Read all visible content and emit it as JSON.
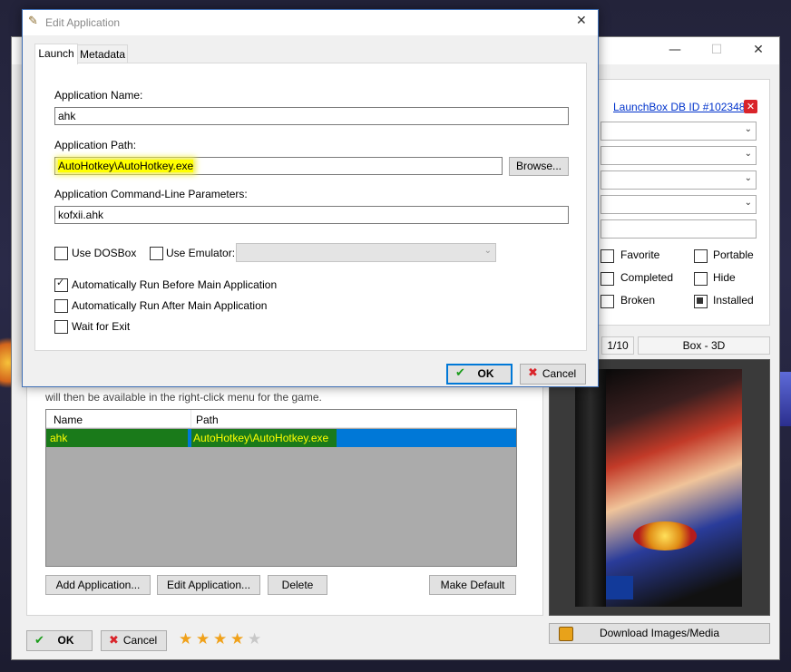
{
  "dialog": {
    "title": "Edit Application",
    "tabs": [
      {
        "label": "Launch"
      },
      {
        "label": "Metadata"
      }
    ],
    "app_name_label": "Application Name:",
    "app_name_value": "ahk",
    "app_path_label": "Application Path:",
    "app_path_value": "AutoHotkey\\AutoHotkey.exe",
    "browse_label": "Browse...",
    "cmdline_label": "Application Command-Line Parameters:",
    "cmdline_value": "kofxii.ahk",
    "use_dosbox_label": "Use DOSBox",
    "use_dosbox_checked": false,
    "use_emulator_label": "Use Emulator:",
    "use_emulator_checked": false,
    "emulator_value": "",
    "auto_run_before_label": "Automatically Run Before Main Application",
    "auto_run_before_checked": true,
    "auto_run_after_label": "Automatically Run After Main Application",
    "auto_run_after_checked": false,
    "wait_for_exit_label": "Wait for Exit",
    "wait_for_exit_checked": false,
    "ok_label": "OK",
    "cancel_label": "Cancel"
  },
  "parent": {
    "caption_text": "will then be available in the right-click menu for the game.",
    "launchbox_link": "LaunchBox DB ID #102348",
    "flags": [
      {
        "label": "Favorite",
        "checked": false
      },
      {
        "label": "Portable",
        "checked": false
      },
      {
        "label": "Completed",
        "checked": false
      },
      {
        "label": "Hide",
        "checked": false
      },
      {
        "label": "Broken",
        "checked": false
      },
      {
        "label": "Installed",
        "checked": true
      }
    ],
    "image_counter": "1/10",
    "image_type": "Box - 3D",
    "download_label": "Download Images/Media",
    "list_columns": [
      "Name",
      "Path"
    ],
    "list_rows": [
      {
        "name": "ahk",
        "path": "AutoHotkey\\AutoHotkey.exe"
      }
    ],
    "add_app_label": "Add Application...",
    "edit_app_label": "Edit Application...",
    "delete_label": "Delete",
    "make_default_label": "Make Default",
    "ok_label": "OK",
    "cancel_label": "Cancel",
    "rating": 4,
    "rating_max": 5
  },
  "colors": {
    "accent": "#0078d7",
    "highlight": "#ffff00",
    "row_highlight": "#1a7a1a",
    "link": "#0033cc",
    "error_icon": "#d9242a"
  }
}
